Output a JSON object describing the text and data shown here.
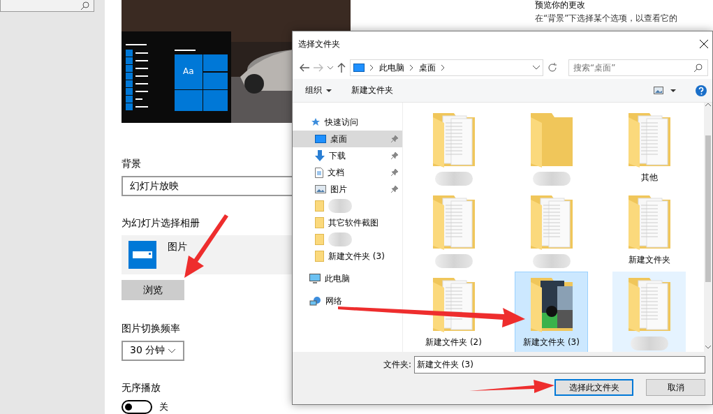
{
  "settings": {
    "preview": {
      "tile_text": "Aa"
    },
    "side_text": {
      "heading": "预览你的更改",
      "lines": [
        "在“背景”下选择某个选项，以查看它的"
      ]
    },
    "background": {
      "label": "背景",
      "value": "幻灯片放映"
    },
    "album": {
      "label": "为幻灯片选择相册",
      "name": "图片",
      "browse": "浏览"
    },
    "interval": {
      "label": "图片切换频率",
      "value": "30 分钟"
    },
    "shuffle": {
      "label": "无序播放",
      "on": false,
      "state_text": "关"
    }
  },
  "dialog": {
    "title": "选择文件夹",
    "path": [
      "此电脑",
      "桌面"
    ],
    "search": {
      "placeholder": "搜索“桌面”"
    },
    "toolbar": {
      "organize": "组织",
      "new_folder": "新建文件夹"
    },
    "nav": [
      {
        "label": "快速访问",
        "kind": "star",
        "selected": false,
        "children": [
          {
            "label": "桌面",
            "kind": "desktop",
            "pinned": true,
            "selected": true
          },
          {
            "label": "下载",
            "kind": "download",
            "pinned": true,
            "selected": false
          },
          {
            "label": "文档",
            "kind": "document",
            "pinned": true,
            "selected": false
          },
          {
            "label": "图片",
            "kind": "pictures",
            "pinned": true,
            "selected": false
          },
          {
            "kind": "folder",
            "pinned": false,
            "selected": false
          },
          {
            "label": "其它软件截图",
            "kind": "folder",
            "pinned": false,
            "selected": false
          },
          {
            "kind": "folder",
            "pinned": false,
            "selected": false
          },
          {
            "label": "新建文件夹 (3)",
            "kind": "folder",
            "pinned": false,
            "selected": false
          }
        ]
      },
      {
        "label": "此电脑",
        "kind": "computer",
        "selected": false
      },
      {
        "label": "网络",
        "kind": "network",
        "selected": false
      }
    ],
    "items": [
      {
        "kind": "docs",
        "selected": false,
        "hover": false
      },
      {
        "kind": "empty",
        "selected": false,
        "hover": false
      },
      {
        "label": "其他",
        "kind": "docs",
        "selected": false,
        "hover": false
      },
      {
        "kind": "docs",
        "selected": false,
        "hover": false
      },
      {
        "kind": "docs",
        "selected": false,
        "hover": false
      },
      {
        "label": "新建文件夹",
        "kind": "docs",
        "selected": false,
        "hover": false
      },
      {
        "label": "新建文件夹 (2)",
        "kind": "docs",
        "selected": false,
        "hover": false
      },
      {
        "label": "新建文件夹 (3)",
        "selected": true,
        "hover": false
      },
      {
        "kind": "docs",
        "selected": false,
        "hover": true
      }
    ],
    "folder_label": "文件夹:",
    "folder_value": "新建文件夹 (3)",
    "buttons": [
      {
        "label": "选择此文件夹",
        "kind": "primary"
      },
      {
        "label": "取消",
        "kind": "normal"
      }
    ]
  }
}
